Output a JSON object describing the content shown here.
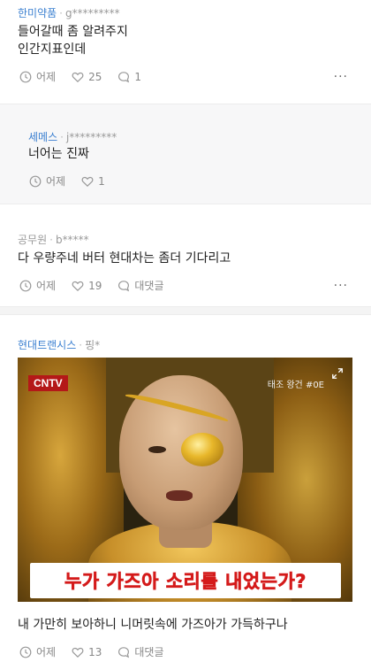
{
  "posts": [
    {
      "company": "한미약품",
      "user": "g*********",
      "lines": [
        "들어갈때 좀 알려주지",
        "인간지표인데"
      ],
      "time": "어제",
      "likes": "25",
      "comments": "1"
    },
    {
      "company": "세메스",
      "user": "j*********",
      "lines": [
        "너어는 진짜"
      ],
      "time": "어제",
      "likes": "1"
    },
    {
      "company": "공무원",
      "user": "b*****",
      "lines": [
        "다 우량주네 버터 현대차는 좀더 기다리고"
      ],
      "time": "어제",
      "likes": "19",
      "comments": "대댓글"
    },
    {
      "company": "현대트랜시스",
      "user": "핑*",
      "image": {
        "logo": "CNTV",
        "top_right": "태조 왕건 #0E",
        "caption": "누가 가즈아 소리를 내었는가?"
      },
      "lines": [
        "내 가만히 보아하니 니머릿속에 가즈아가 가득하구나"
      ],
      "time": "어제",
      "likes": "13",
      "comments": "대댓글"
    }
  ],
  "more_label": "···",
  "separator": "·",
  "icons": {
    "clock": "clock-icon",
    "heart": "heart-icon",
    "comment": "comment-icon",
    "expand": "expand-icon"
  },
  "colors": {
    "company": "#3a7fd0",
    "meta": "#999999",
    "caption": "#d41a1a"
  }
}
